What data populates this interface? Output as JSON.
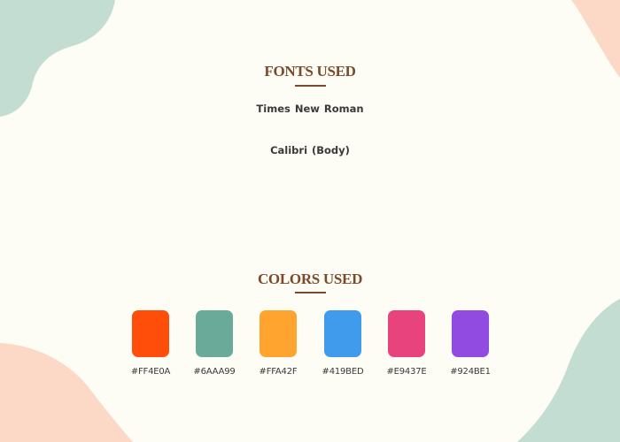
{
  "fonts_section": {
    "heading": "FONTS USED",
    "fonts": [
      "Times New Roman",
      "Calibri  (Body)"
    ]
  },
  "colors_section": {
    "heading": "COLORS USED",
    "swatches": [
      {
        "hex": "#FF4E0A",
        "label": "#FF4E0A"
      },
      {
        "hex": "#6AAA99",
        "label": "#6AAA99"
      },
      {
        "hex": "#FFA42F",
        "label": "#FFA42F"
      },
      {
        "hex": "#419BED",
        "label": "#419BED"
      },
      {
        "hex": "#E9437E",
        "label": "#E9437E"
      },
      {
        "hex": "#924BE1",
        "label": "#924BE1"
      }
    ]
  },
  "theme": {
    "background": "#FDFCF5",
    "accent_green": "#C4DDD2",
    "accent_peach": "#FCD9C6",
    "heading_color": "#7B4A2A"
  }
}
